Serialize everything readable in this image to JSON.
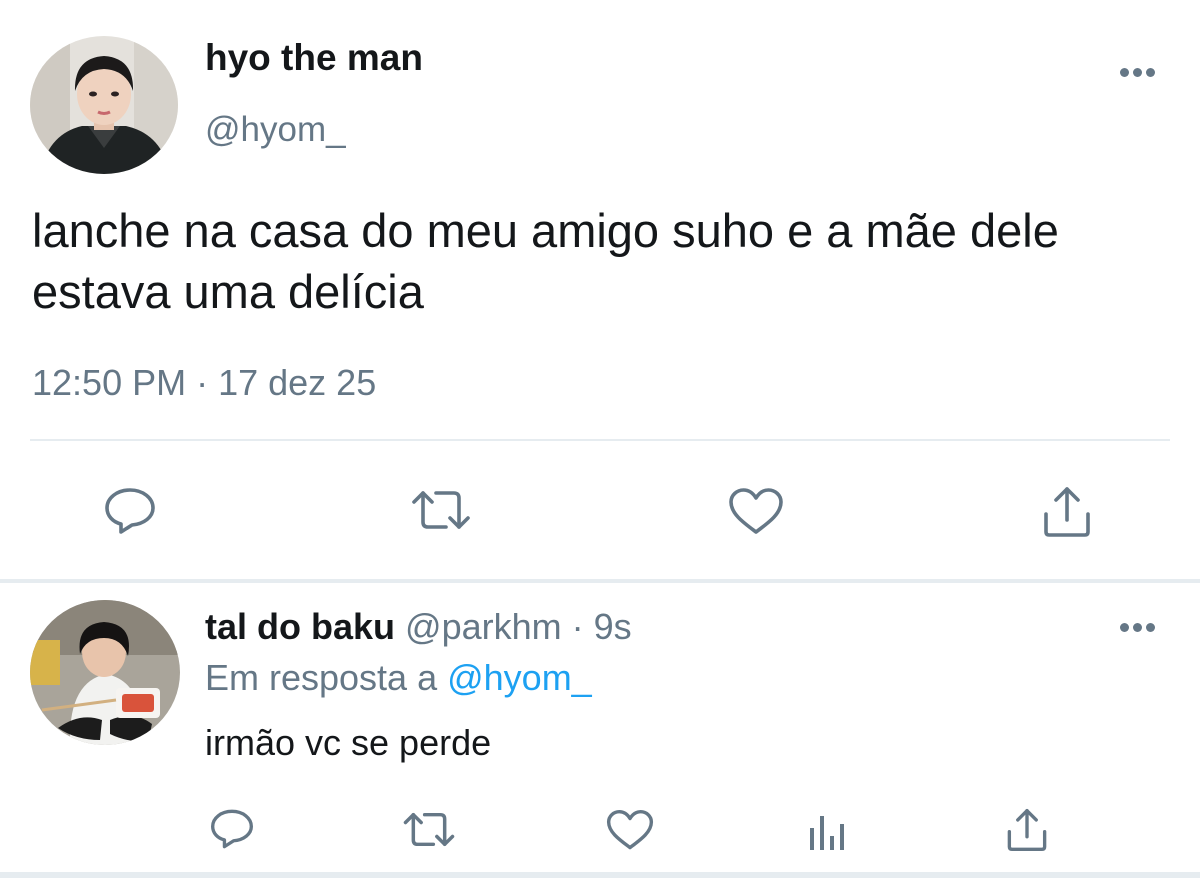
{
  "tweet": {
    "display_name": "hyo the man",
    "handle": "@hyom_",
    "text": "lanche na casa do meu amigo suho e a mãe dele estava uma delícia",
    "time": "12:50 PM · 17 dez 25",
    "actions": [
      "reply-icon",
      "retweet-icon",
      "like-icon",
      "share-icon"
    ]
  },
  "reply": {
    "display_name": "tal do baku",
    "handle_time": "@parkhm · 9s",
    "in_reply_prefix": "Em resposta a ",
    "in_reply_handle": "@hyom_",
    "text": "irmão vc se perde",
    "actions": [
      "reply-icon",
      "retweet-icon",
      "like-icon",
      "analytics-icon",
      "share-icon"
    ]
  },
  "colors": {
    "text": "#14171a",
    "secondary": "#657786",
    "link": "#1da1f2",
    "divider": "#e6ecf0"
  }
}
